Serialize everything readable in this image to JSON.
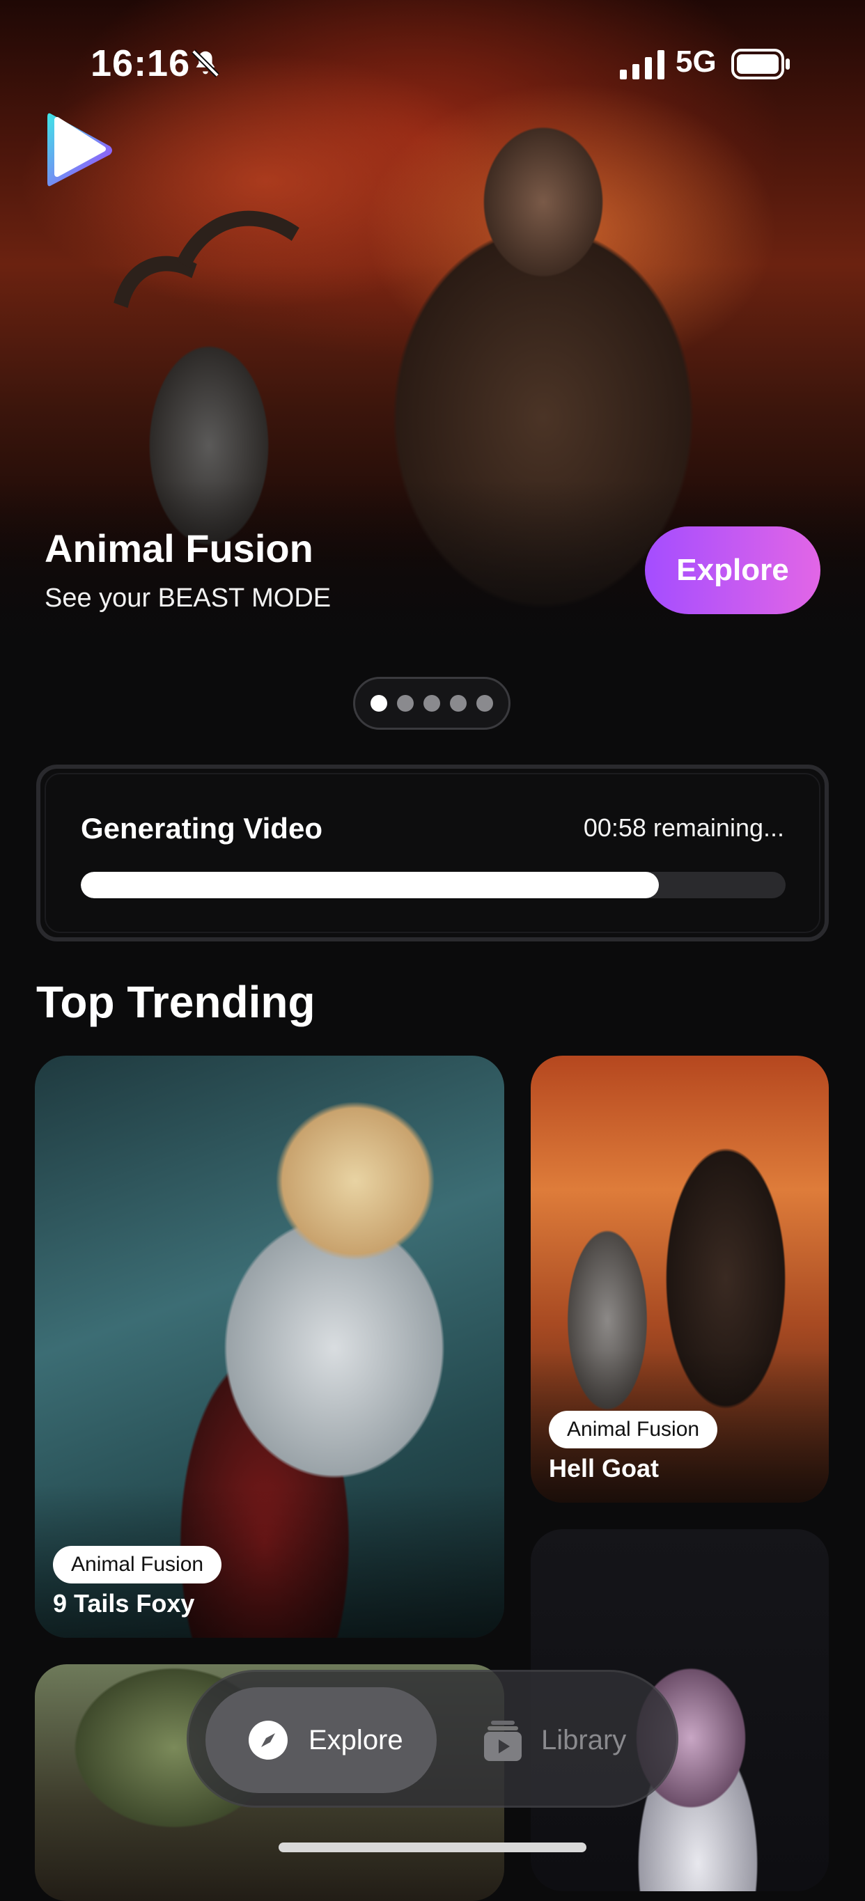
{
  "status_bar": {
    "time": "16:16",
    "network": "5G",
    "icons": [
      "bell-slash-icon",
      "cellular-signal-icon",
      "battery-icon"
    ]
  },
  "hero": {
    "title": "Animal Fusion",
    "subtitle": "See your BEAST MODE",
    "button_label": "Explore",
    "pager": {
      "count": 5,
      "active_index": 0
    }
  },
  "generating": {
    "title": "Generating Video",
    "remaining": "00:58 remaining...",
    "progress_percent": 82
  },
  "trending": {
    "title": "Top Trending",
    "cards": [
      {
        "tag": "Animal Fusion",
        "title": "9 Tails Foxy"
      },
      {
        "tag": "Animal Fusion",
        "title": "Hell Goat"
      }
    ]
  },
  "tabbar": {
    "explore_label": "Explore",
    "library_label": "Library",
    "active": "explore"
  },
  "colors": {
    "background": "#0b0b0c",
    "accent_start": "#a44dff",
    "accent_end": "#e266e6",
    "progress_fill": "#ffffff",
    "progress_track": "#2a2a2d"
  }
}
